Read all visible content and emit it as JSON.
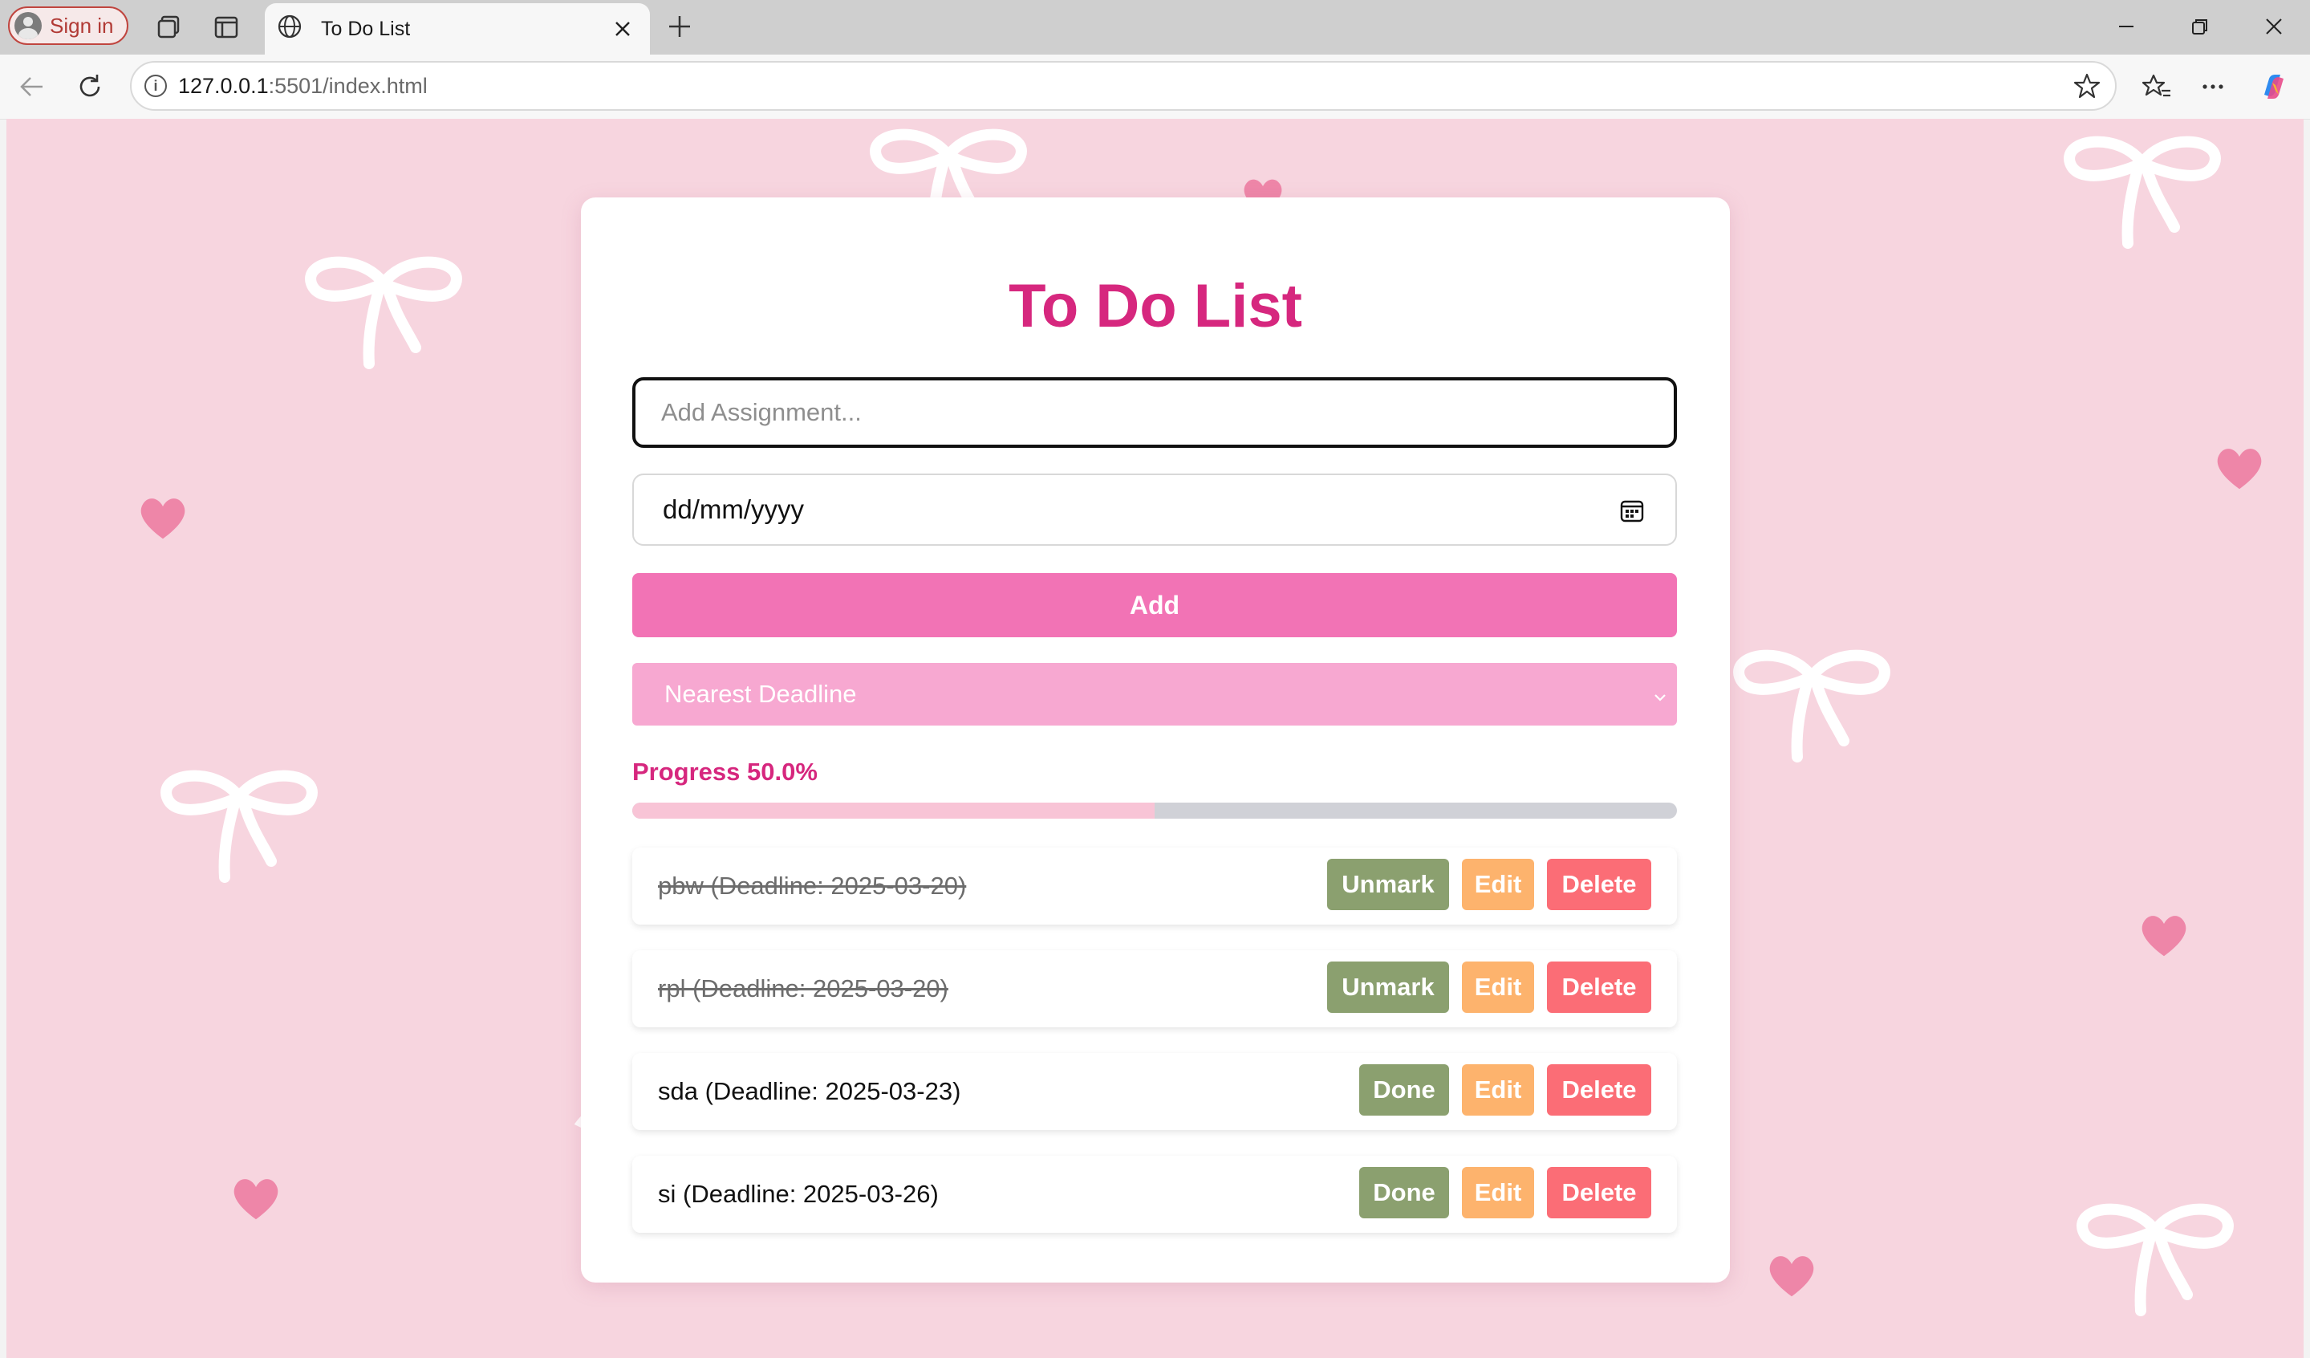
{
  "browser": {
    "signin_label": "Sign in",
    "tab_title": "To Do List",
    "url_host": "127.0.0.1",
    "url_rest": ":5501/index.html"
  },
  "app": {
    "title": "To Do List",
    "task_placeholder": "Add Assignment...",
    "date_placeholder": "dd/mm/yyyy",
    "add_label": "Add",
    "sort_selected": "Nearest Deadline",
    "progress_label": "Progress 50.0%",
    "progress_fraction": 0.5,
    "tasks": [
      {
        "text": "pbw (Deadline: 2025-03-20)",
        "completed": true,
        "toggle_label": "Unmark",
        "edit_label": "Edit",
        "delete_label": "Delete"
      },
      {
        "text": "rpl (Deadline: 2025-03-20)",
        "completed": true,
        "toggle_label": "Unmark",
        "edit_label": "Edit",
        "delete_label": "Delete"
      },
      {
        "text": "sda (Deadline: 2025-03-23)",
        "completed": false,
        "toggle_label": "Done",
        "edit_label": "Edit",
        "delete_label": "Delete"
      },
      {
        "text": "si (Deadline: 2025-03-26)",
        "completed": false,
        "toggle_label": "Done",
        "edit_label": "Edit",
        "delete_label": "Delete"
      }
    ]
  },
  "colors": {
    "accent": "#d6277e",
    "add_button": "#f273b5",
    "select_bg": "#f7a8d1",
    "done_button": "#8ba06f",
    "edit_button": "#fdb36d",
    "delete_button": "#fb6d76",
    "page_bg": "#f7d5df"
  },
  "icons": {
    "avatar": "person-avatar-icon",
    "workspaces": "workspaces-icon",
    "tab_actions": "vertical-tabs-icon",
    "tab_favicon": "globe-icon",
    "tab_close": "close-icon",
    "new_tab": "plus-icon",
    "back": "arrow-left-icon",
    "reload": "reload-icon",
    "site_info": "info-icon",
    "favorite": "star-icon",
    "favorites": "favorites-icon",
    "more": "ellipsis-icon",
    "copilot": "copilot-icon",
    "calendar": "calendar-icon",
    "dropdown": "chevron-down-icon"
  }
}
